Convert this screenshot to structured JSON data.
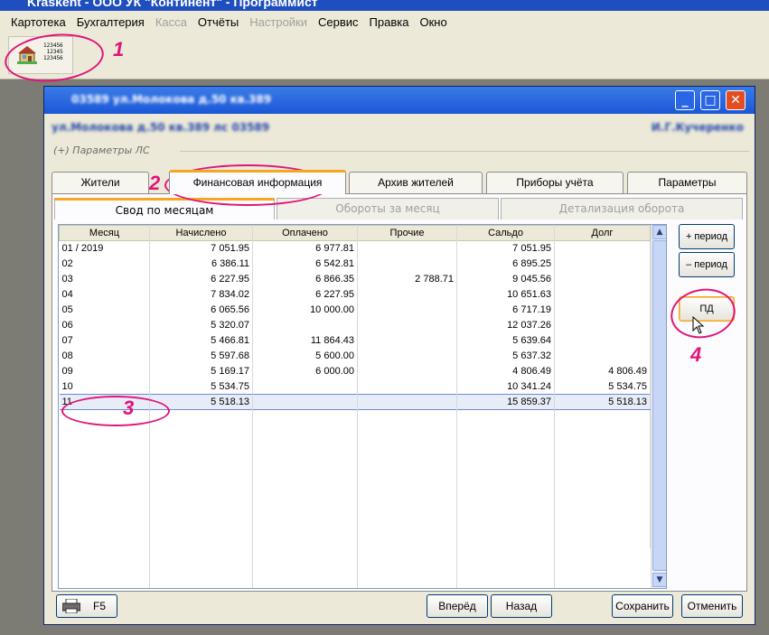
{
  "app": {
    "title": "Kraskent - ООО УК \"Континент\" - Программист"
  },
  "menu": [
    {
      "label": "Картотека",
      "enabled": true
    },
    {
      "label": "Бухгалтерия",
      "enabled": true
    },
    {
      "label": "Касса",
      "enabled": false
    },
    {
      "label": "Отчёты",
      "enabled": true
    },
    {
      "label": "Настройки",
      "enabled": false
    },
    {
      "label": "Сервис",
      "enabled": true
    },
    {
      "label": "Правка",
      "enabled": true
    },
    {
      "label": "Окно",
      "enabled": true
    }
  ],
  "toolbar": {
    "code_lines": [
      "123456",
      "12345",
      "123456"
    ]
  },
  "annotations": {
    "a1": "1",
    "a2": "2",
    "a3": "3",
    "a4": "4"
  },
  "window": {
    "title": "03589 ул.Молокова д.50 кв.389",
    "info_left": "ул.Молокова д.50 кв.389 лс 03589",
    "info_right": "И.Г.Кучеренко",
    "params_label": "(+)  Параметры ЛС"
  },
  "tabs": [
    "Жители",
    "Финансовая информация",
    "Архив жителей",
    "Приборы учёта",
    "Параметры"
  ],
  "subtabs": [
    "Свод по месяцам",
    "Обороты за месяц",
    "Детализация оборота"
  ],
  "table": {
    "headers": [
      "Месяц",
      "Начислено",
      "Оплачено",
      "Прочие",
      "Сальдо",
      "Долг"
    ],
    "rows": [
      [
        "01 / 2019",
        "7 051.95",
        "6 977.81",
        "",
        "7 051.95",
        ""
      ],
      [
        "02",
        "6 386.11",
        "6 542.81",
        "",
        "6 895.25",
        ""
      ],
      [
        "03",
        "6 227.95",
        "6 866.35",
        "2 788.71",
        "9 045.56",
        ""
      ],
      [
        "04",
        "7 834.02",
        "6 227.95",
        "",
        "10 651.63",
        ""
      ],
      [
        "05",
        "6 065.56",
        "10 000.00",
        "",
        "6 717.19",
        ""
      ],
      [
        "06",
        "5 320.07",
        "",
        "",
        "12 037.26",
        ""
      ],
      [
        "07",
        "5 466.81",
        "11 864.43",
        "",
        "5 639.64",
        ""
      ],
      [
        "08",
        "5 597.68",
        "5 600.00",
        "",
        "5 637.32",
        ""
      ],
      [
        "09",
        "5 169.17",
        "6 000.00",
        "",
        "4 806.49",
        "4 806.49"
      ],
      [
        "10",
        "5 534.75",
        "",
        "",
        "10 341.24",
        "5 534.75"
      ],
      [
        "11",
        "5 518.13",
        "",
        "",
        "15 859.37",
        "5 518.13"
      ]
    ],
    "selected_row": 10
  },
  "side_buttons": {
    "add_period": "+ период",
    "remove_period": "– период",
    "pd": "ПД"
  },
  "bottom": {
    "print_key": "F5",
    "forward": "Вперёд",
    "back": "Назад",
    "save": "Сохранить",
    "cancel": "Отменить"
  }
}
